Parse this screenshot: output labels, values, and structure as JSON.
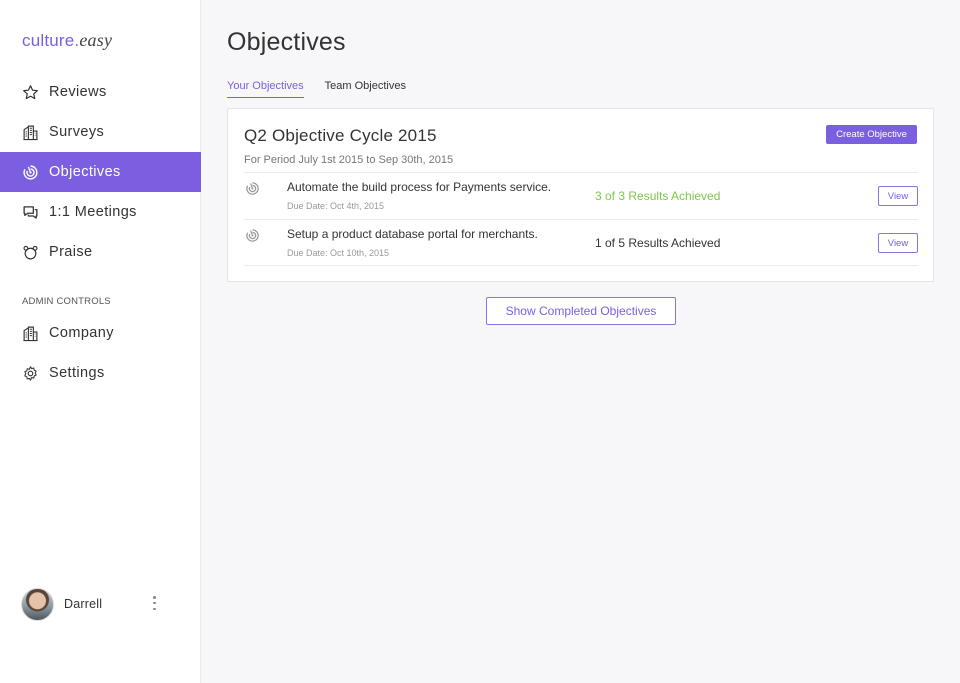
{
  "brand": {
    "part1": "culture.",
    "part2": "easy",
    "accent": "#7b5fe0"
  },
  "sidebar": {
    "items": [
      {
        "label": "Reviews",
        "icon": "star-icon",
        "active": false
      },
      {
        "label": "Surveys",
        "icon": "building-icon",
        "active": false
      },
      {
        "label": "Objectives",
        "icon": "target-icon",
        "active": true
      },
      {
        "label": "1:1 Meetings",
        "icon": "chat-icon",
        "active": false
      },
      {
        "label": "Praise",
        "icon": "bear-icon",
        "active": false
      }
    ],
    "admin_label": "ADMIN CONTROLS",
    "admin_items": [
      {
        "label": "Company",
        "icon": "building-icon"
      },
      {
        "label": "Settings",
        "icon": "gear-icon"
      }
    ],
    "user": {
      "name": "Darrell"
    }
  },
  "main": {
    "title": "Objectives",
    "tabs": [
      {
        "label": "Your Objectives",
        "active": true
      },
      {
        "label": "Team Objectives",
        "active": false
      }
    ],
    "cycle": {
      "title": "Q2 Objective Cycle 2015",
      "period": "For Period July 1st 2015 to Sep 30th, 2015",
      "create_label": "Create Objective",
      "objectives": [
        {
          "title": "Automate the build process for Payments service.",
          "due": "Due Date: Oct 4th, 2015",
          "status": "3 of 3 Results Achieved",
          "complete": true,
          "view_label": "View"
        },
        {
          "title": "Setup a product database portal for merchants.",
          "due": "Due Date: Oct 10th, 2015",
          "status": "1 of 5 Results Achieved",
          "complete": false,
          "view_label": "View"
        }
      ]
    },
    "show_completed_label": "Show Completed Objectives"
  },
  "colors": {
    "accent": "#7b5fe0",
    "success": "#7cc84a",
    "background": "#f7f7f9"
  }
}
